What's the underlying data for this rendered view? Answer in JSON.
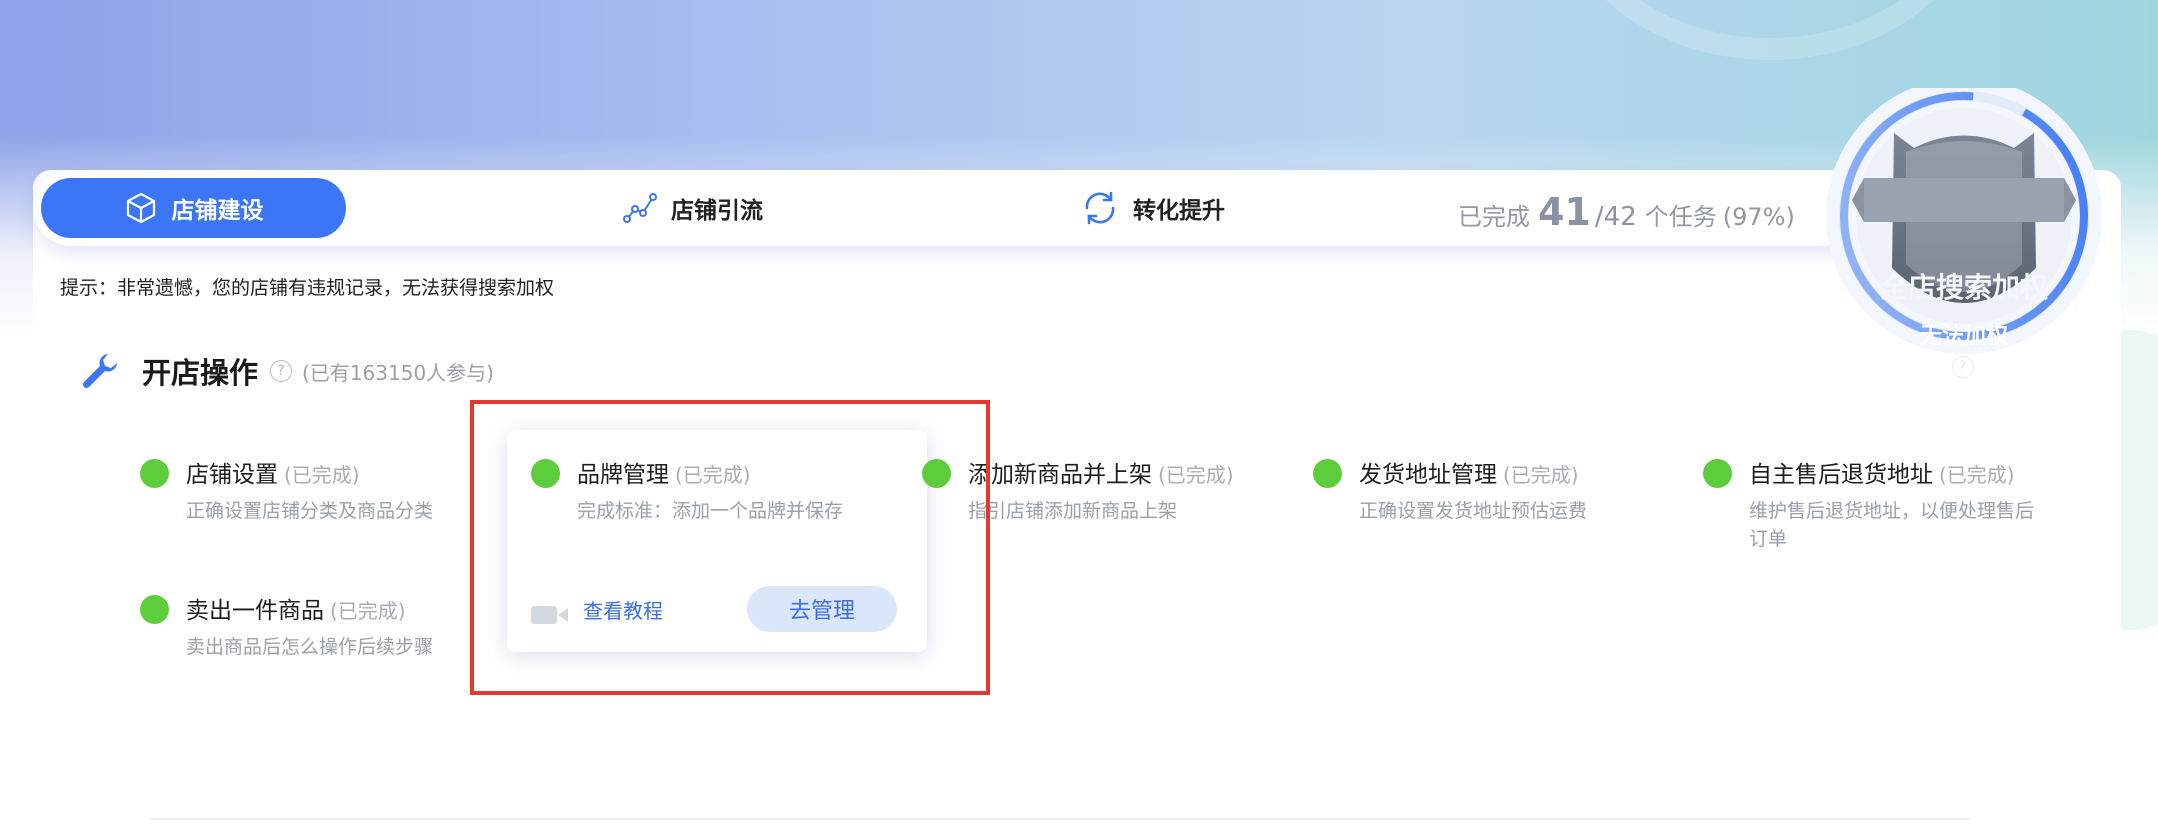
{
  "tabs": [
    {
      "label": "店铺建设",
      "active": true
    },
    {
      "label": "店铺引流",
      "active": false
    },
    {
      "label": "转化提升",
      "active": false
    }
  ],
  "progress": {
    "prefix": "已完成",
    "done": "41",
    "total": "/42",
    "suffix": "个任务",
    "percent": "(97%)"
  },
  "badge": {
    "title": "全店搜索加权",
    "status": "无法加权",
    "help": "?"
  },
  "tip": "提示：非常遗憾，您的店铺有违规记录，无法获得搜索加权",
  "section": {
    "title": "开店操作",
    "help": "?",
    "participants": "(已有163150人参与)"
  },
  "tasks": [
    {
      "name": "店铺设置",
      "status": "(已完成)",
      "desc": "正确设置店铺分类及商品分类"
    },
    {
      "name": "品牌管理",
      "status": "(已完成)",
      "desc": "完成标准：添加一个品牌并保存"
    },
    {
      "name": "添加新商品并上架",
      "status": "(已完成)",
      "desc": "指引店铺添加新商品上架"
    },
    {
      "name": "发货地址管理",
      "status": "(已完成)",
      "desc": "正确设置发货地址预估运费"
    },
    {
      "name": "自主售后退货地址",
      "status": "(已完成)",
      "desc": "维护售后退货地址，以便处理售后订单"
    },
    {
      "name": "卖出一件商品",
      "status": "(已完成)",
      "desc": "卖出商品后怎么操作后续步骤"
    }
  ],
  "popup": {
    "tutorial_label": "查看教程",
    "manage_label": "去管理"
  },
  "colors": {
    "accent": "#3a76f5",
    "done_dot": "#5dcd3c",
    "highlight_box": "#e23a2e"
  },
  "icons": {
    "tab1": "box-icon",
    "tab2": "trend-line-icon",
    "tab3": "refresh-icon",
    "section": "wrench-icon",
    "popup": "video-camera-icon"
  }
}
